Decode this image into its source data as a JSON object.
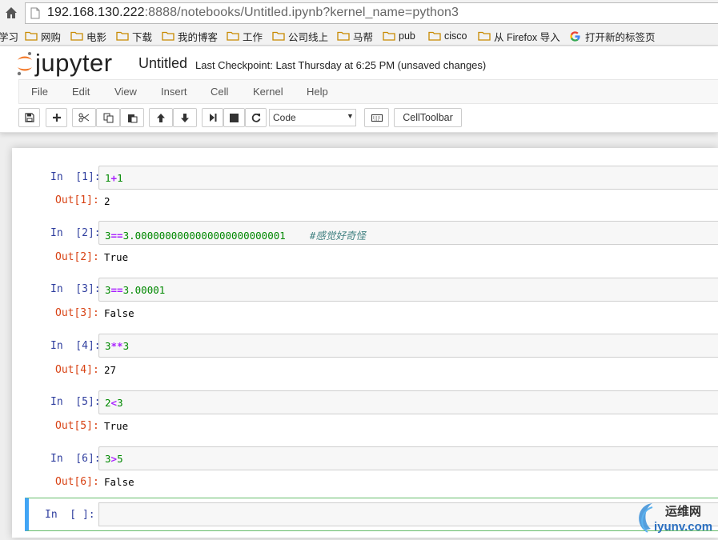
{
  "browser": {
    "url_host": "192.168.130.222",
    "url_rest": ":8888/notebooks/Untitled.ipynb?kernel_name=python3",
    "bookmarks": [
      "学习",
      "网购",
      "电影",
      "下载",
      "我的博客",
      "工作",
      "公司线上",
      "马帮",
      "pub",
      "cisco",
      "从 Firefox 导入",
      "打开新的标签页"
    ]
  },
  "header": {
    "logo_text": "jupyter",
    "notebook_title": "Untitled",
    "checkpoint": "Last Checkpoint: Last Thursday at 6:25 PM (unsaved changes)"
  },
  "menu": [
    "File",
    "Edit",
    "View",
    "Insert",
    "Cell",
    "Kernel",
    "Help"
  ],
  "toolbar": {
    "cell_type": "Code",
    "celltoolbar_label": "CellToolbar"
  },
  "cells": [
    {
      "in_prompt": "In  [1]:",
      "out_prompt": "Out[1]:",
      "output": "2"
    },
    {
      "in_prompt": "In  [2]:",
      "out_prompt": "Out[2]:",
      "output": "True",
      "comment": "#感觉好奇怪"
    },
    {
      "in_prompt": "In  [3]:",
      "out_prompt": "Out[3]:",
      "output": "False"
    },
    {
      "in_prompt": "In  [4]:",
      "out_prompt": "Out[4]:",
      "output": "27"
    },
    {
      "in_prompt": "In  [5]:",
      "out_prompt": "Out[5]:",
      "output": "True"
    },
    {
      "in_prompt": "In  [6]:",
      "out_prompt": "Out[6]:",
      "output": "False"
    }
  ],
  "active_cell": {
    "in_prompt": "In  [ ]:"
  },
  "watermark": {
    "cn": "运维网",
    "domain": "iyunv.com"
  },
  "colors": {
    "prompt_in": "#303f9f",
    "prompt_out": "#d84315",
    "number": "#008800",
    "operator": "#aa22ff",
    "comment": "#408080",
    "logo_orange": "#f37726"
  }
}
